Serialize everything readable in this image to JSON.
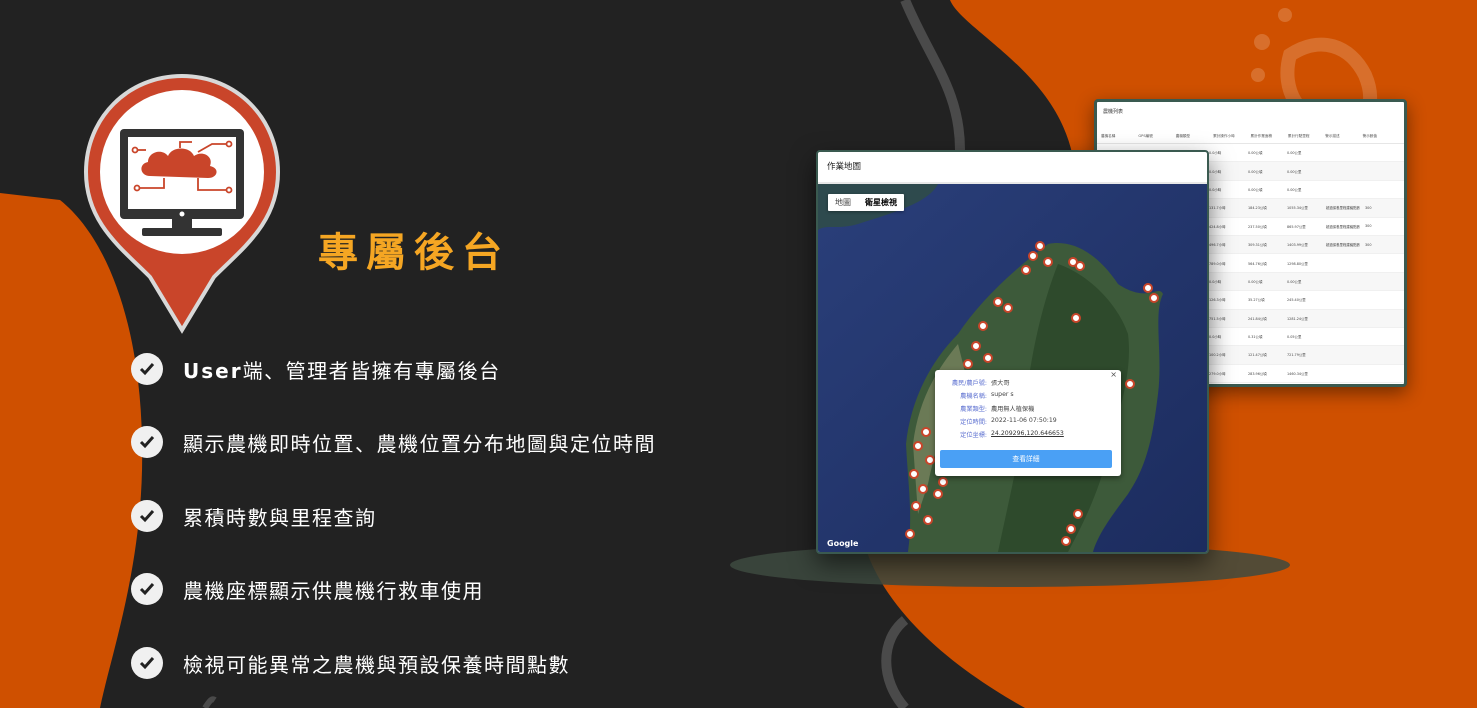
{
  "hero": {
    "title": "專屬後台"
  },
  "features": [
    {
      "bold": "User",
      "text": "端、管理者皆擁有專屬後台"
    },
    {
      "bold": "",
      "text": "顯示農機即時位置、農機位置分布地圖與定位時間"
    },
    {
      "bold": "",
      "text": "累積時數與里程查詢"
    },
    {
      "bold": "",
      "text": "農機座標顯示供農機行救車使用"
    },
    {
      "bold": "",
      "text": "檢視可能異常之農機與預設保養時間點數"
    }
  ],
  "table_card": {
    "title": "農機列表",
    "headers": [
      "農機名稱",
      "GPS編號",
      "農機類型",
      "累計操作小時",
      "累計作業面積",
      "累計行駛里程",
      "警示描述",
      "警示數值"
    ],
    "rows": [
      [
        "0.0小時",
        "0.00公頃",
        "0.00公里",
        "",
        ""
      ],
      [
        "0.0小時",
        "0.00公頃",
        "0.00公里",
        "",
        ""
      ],
      [
        "0.0小時",
        "0.00公頃",
        "0.00公里",
        "",
        ""
      ],
      [
        "131.7小時",
        "184.23公頃",
        "1055.34公里",
        "超過保養里程建議點數",
        "300"
      ],
      [
        "424.8小時",
        "237.50公頃",
        "865.97公里",
        "超過保養里程建議點數",
        "300"
      ],
      [
        "496.7小時",
        "309.31公頃",
        "1403.99公里",
        "超過保養里程建議點數",
        "300"
      ],
      [
        "789.0小時",
        "564.76公頃",
        "1298.80公里",
        "",
        ""
      ],
      [
        "0.0小時",
        "0.00公頃",
        "0.00公里",
        "",
        ""
      ],
      [
        "126.3小時",
        "35.27公頃",
        "245.40公里",
        "",
        ""
      ],
      [
        "751.5小時",
        "241.84公頃",
        "1281.24公里",
        "",
        ""
      ],
      [
        "0.0小時",
        "0.31公頃",
        "0.05公里",
        "",
        ""
      ],
      [
        "100.2小時",
        "121.47公頃",
        "721.79公里",
        "",
        ""
      ],
      [
        "279.0小時",
        "283.96公頃",
        "1460.34公里",
        "",
        ""
      ]
    ]
  },
  "map_card": {
    "title": "作業地圖",
    "tabs": [
      "地圖",
      "衛星檢視"
    ],
    "active_tab": "衛星檢視",
    "google": "Google",
    "popup": {
      "close": "×",
      "fields": [
        {
          "label": "農民/農戶號:",
          "value": "張大哥"
        },
        {
          "label": "農機名稱:",
          "value": "super s"
        },
        {
          "label": "農業類型:",
          "value": "農用無人植保機"
        },
        {
          "label": "定位時間:",
          "value": "2022-11-06 07:50:19"
        },
        {
          "label": "定位坐標:",
          "value": "24.209296,120.646653"
        }
      ],
      "button": "查看詳細"
    }
  },
  "colors": {
    "background": "#222222",
    "orange": "#cf5000",
    "title": "#f5a623",
    "pin": "#c9452a",
    "card_border": "#3a5a50",
    "button": "#4aa0f5"
  }
}
